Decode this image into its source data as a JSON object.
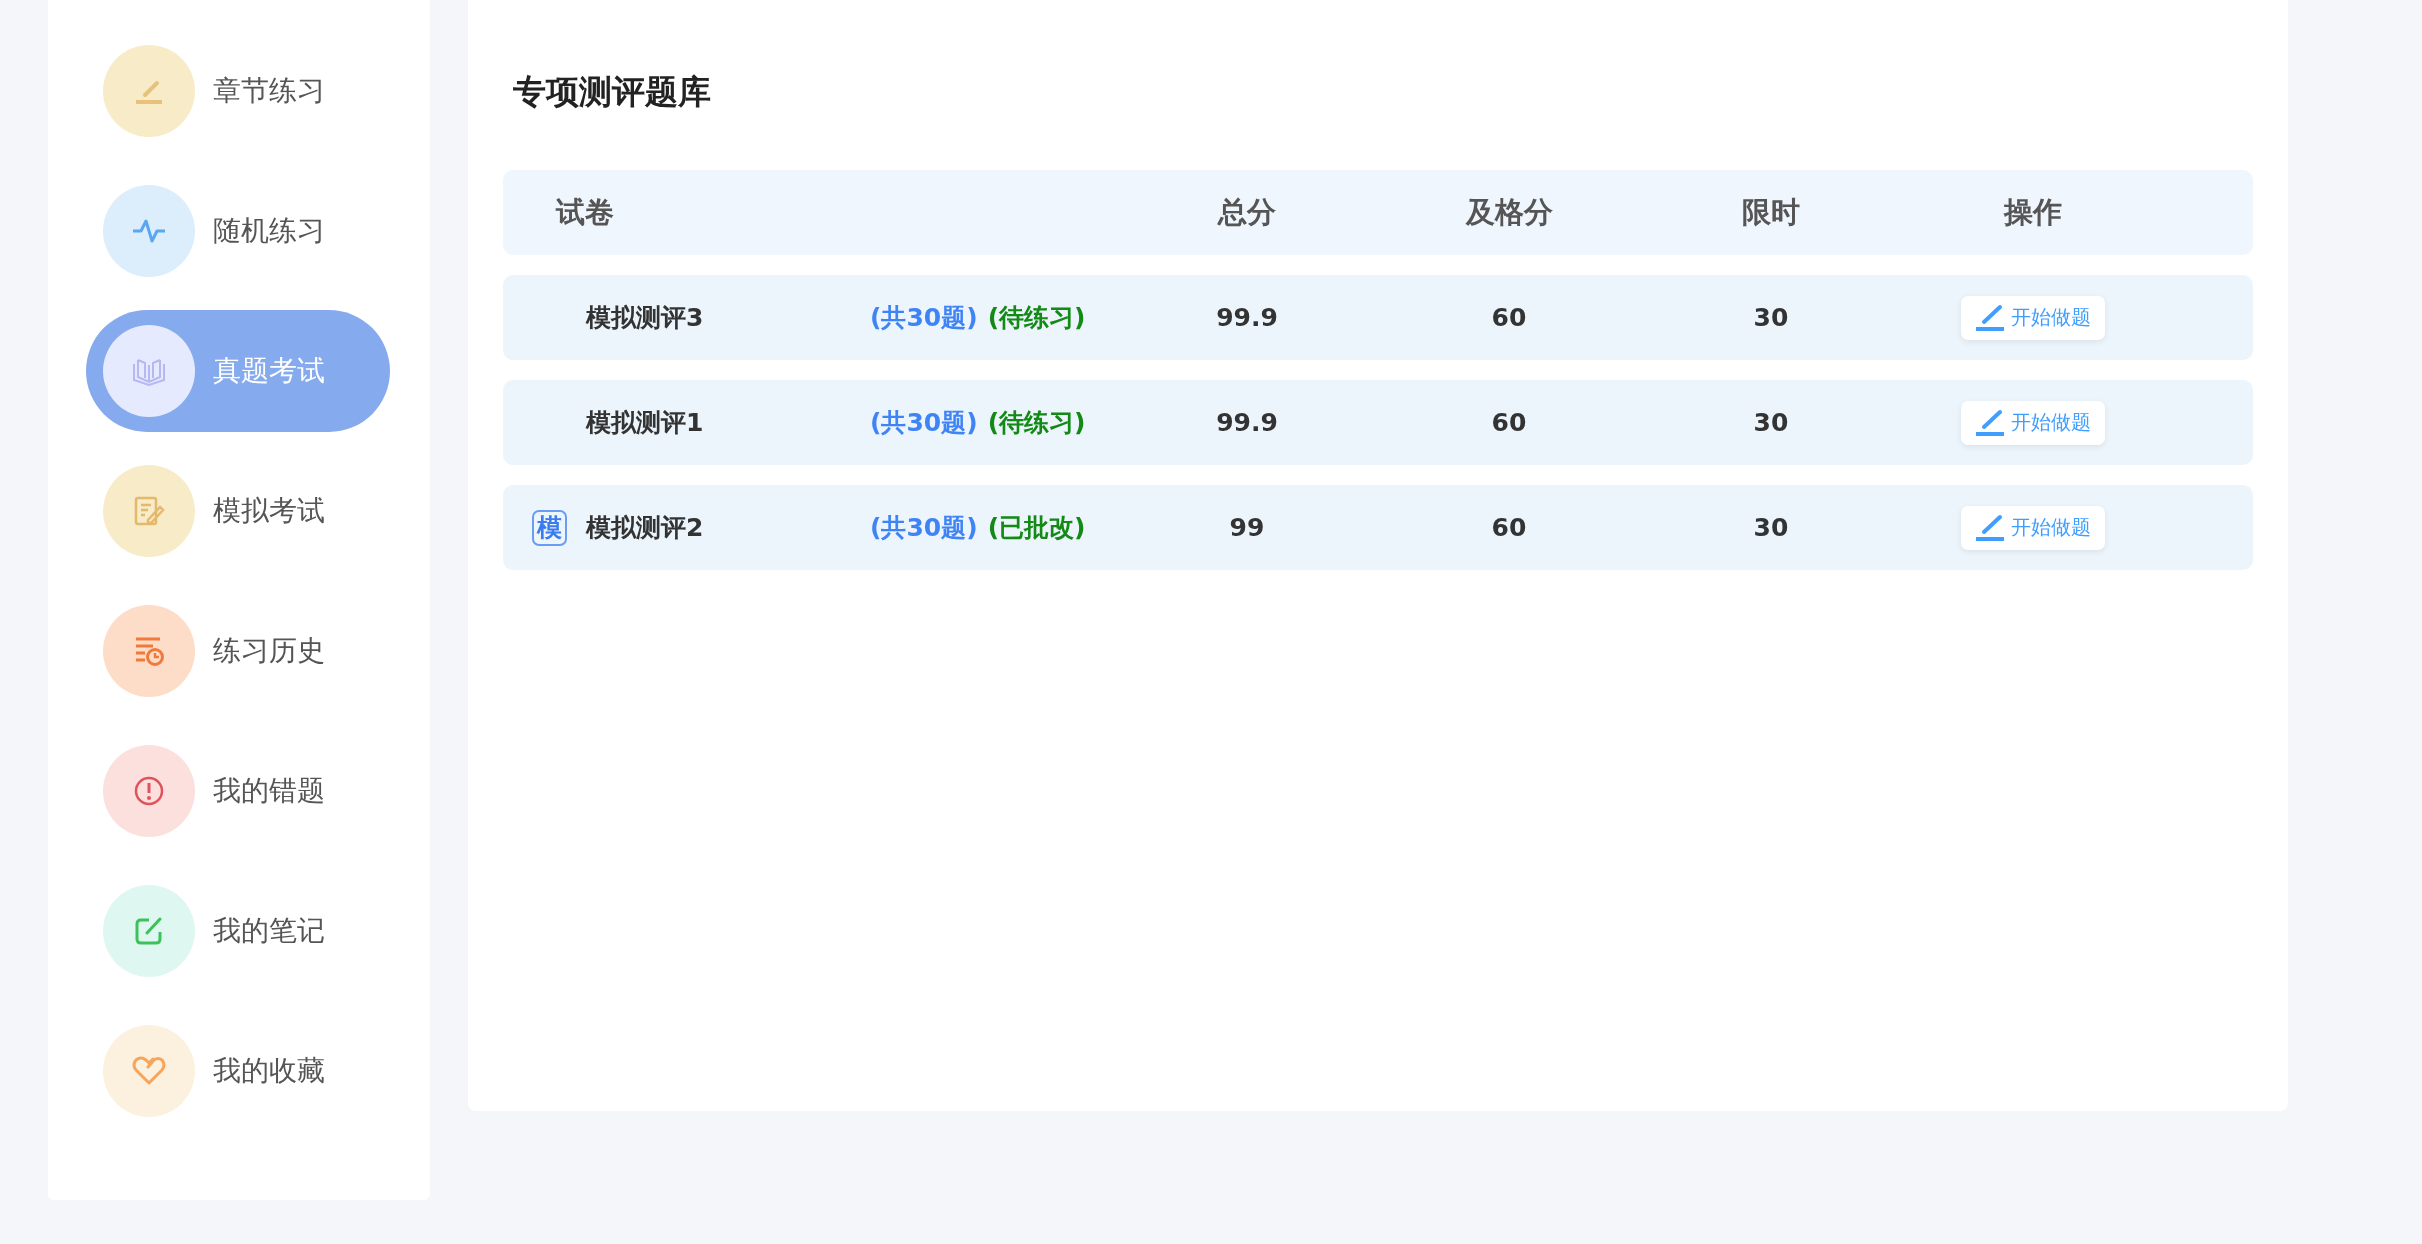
{
  "sidebar": {
    "items": [
      {
        "label": "章节练习",
        "kind": "pencil",
        "color": "#f7ebc8",
        "selected": false
      },
      {
        "label": "随机练习",
        "kind": "pulse",
        "color": "#dcedfb",
        "selected": false
      },
      {
        "label": "真题考试",
        "kind": "book",
        "color": "#e6eafe",
        "selected": true
      },
      {
        "label": "模拟考试",
        "kind": "note",
        "color": "#f7ebc8",
        "selected": false
      },
      {
        "label": "练习历史",
        "kind": "history",
        "color": "#fddcc8",
        "selected": false
      },
      {
        "label": "我的错题",
        "kind": "alert",
        "color": "#fbe0dd",
        "selected": false
      },
      {
        "label": "我的笔记",
        "kind": "edit",
        "color": "#def7f0",
        "selected": false
      },
      {
        "label": "我的收藏",
        "kind": "heart",
        "color": "#fcf1de",
        "selected": false
      }
    ]
  },
  "main": {
    "title": "专项测评题库",
    "table": {
      "columns": [
        "试卷",
        "总分",
        "及格分",
        "限时",
        "操作"
      ],
      "rows": [
        {
          "badge": null,
          "name": "模拟测评3",
          "count": "(共30题)",
          "status": "(待练习)",
          "total": "99.9",
          "pass": "60",
          "time": "30",
          "action": "开始做题"
        },
        {
          "badge": null,
          "name": "模拟测评1",
          "count": "(共30题)",
          "status": "(待练习)",
          "total": "99.9",
          "pass": "60",
          "time": "30",
          "action": "开始做题"
        },
        {
          "badge": "模",
          "name": "模拟测评2",
          "count": "(共30题)",
          "status": "(已批改)",
          "total": "99",
          "pass": "60",
          "time": "30",
          "action": "开始做题"
        }
      ]
    }
  }
}
